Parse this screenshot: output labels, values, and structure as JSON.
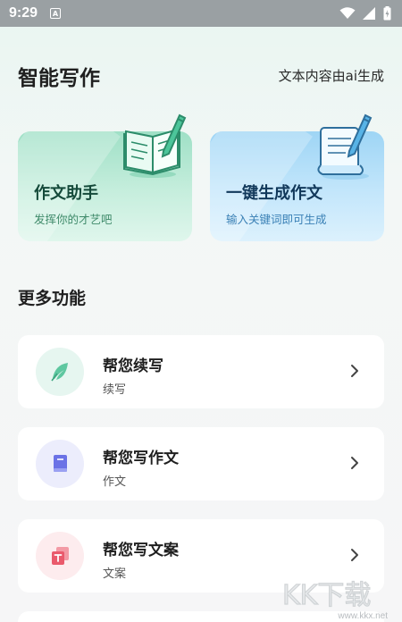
{
  "status_bar": {
    "time": "9:29",
    "app_icon_letter": "A"
  },
  "header": {
    "title": "智能写作",
    "note": "文本内容由ai生成"
  },
  "feature_cards": [
    {
      "title": "作文助手",
      "subtitle": "发挥你的才艺吧",
      "icon": "notebook-pen-icon",
      "color": "#9fe0c6"
    },
    {
      "title": "一键生成作文",
      "subtitle": "输入关键词即可生成",
      "icon": "scroll-pen-icon",
      "color": "#9ed5f5"
    }
  ],
  "section": {
    "title": "更多功能"
  },
  "functions": [
    {
      "title": "帮您续写",
      "subtitle": "续写",
      "icon": "feather-icon",
      "color": "#5ec7a0"
    },
    {
      "title": "帮您写作文",
      "subtitle": "作文",
      "icon": "book-icon",
      "color": "#6b72e6"
    },
    {
      "title": "帮您写文案",
      "subtitle": "文案",
      "icon": "document-t-icon",
      "color": "#ea5a6c"
    }
  ],
  "watermark": {
    "logo_text": "KK下载",
    "url": "www.kkx.net"
  }
}
